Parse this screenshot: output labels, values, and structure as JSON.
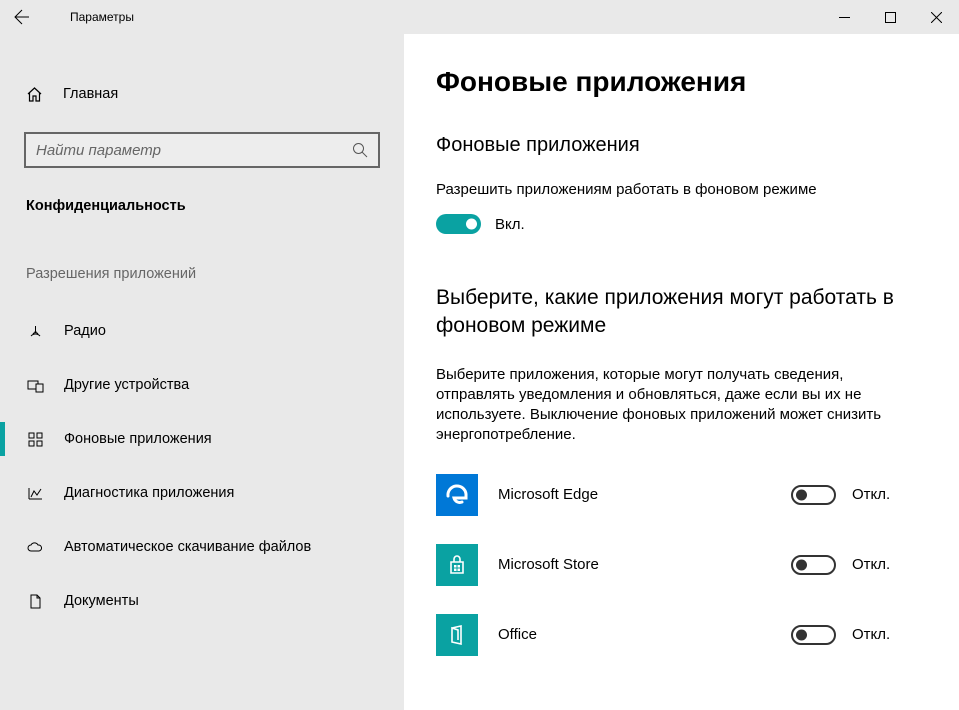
{
  "window": {
    "title": "Параметры"
  },
  "sidebar": {
    "home": "Главная",
    "search_placeholder": "Найти параметр",
    "section": "Конфиденциальность",
    "subsection": "Разрешения приложений",
    "items": [
      {
        "label": "Радио"
      },
      {
        "label": "Другие устройства"
      },
      {
        "label": "Фоновые приложения"
      },
      {
        "label": "Диагностика приложения"
      },
      {
        "label": "Автоматическое скачивание файлов"
      },
      {
        "label": "Документы"
      }
    ]
  },
  "main": {
    "page_title": "Фоновые приложения",
    "toggle_section_title": "Фоновые приложения",
    "toggle_desc": "Разрешить приложениям работать в фоновом режиме",
    "master_state_label": "Вкл.",
    "list_title": "Выберите, какие приложения могут работать в фоновом режиме",
    "list_desc": "Выберите приложения, которые могут получать сведения, отправлять уведомления и обновляться, даже если вы их не используете. Выключение фоновых приложений может снизить энергопотребление.",
    "off_label": "Откл.",
    "apps": [
      {
        "name": "Microsoft Edge",
        "color": "#0078D7",
        "state": "Откл."
      },
      {
        "name": "Microsoft Store",
        "color": "#0aa2a2",
        "state": "Откл."
      },
      {
        "name": "Office",
        "color": "#0aa2a2",
        "state": "Откл."
      }
    ]
  }
}
